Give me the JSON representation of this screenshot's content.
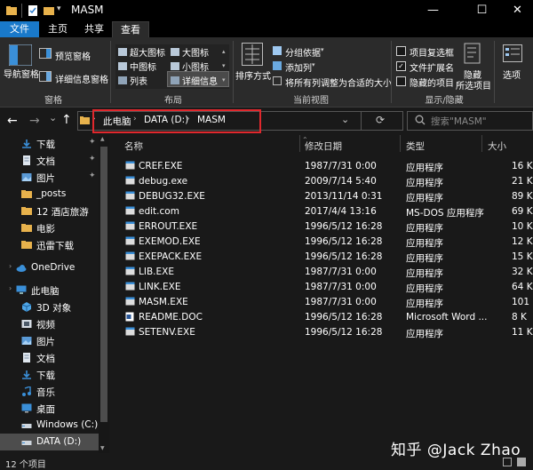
{
  "window": {
    "title": "MASM",
    "minimize": "—",
    "maximize": "☐",
    "close": "✕"
  },
  "tabs": [
    "文件",
    "主页",
    "共享",
    "查看"
  ],
  "ribbon": {
    "pane": {
      "nav_pane": "导航窗格",
      "preview_pane": "预览窗格",
      "details_pane": "详细信息窗格",
      "group_label": "窗格"
    },
    "layout": {
      "xl_icons": "超大图标",
      "large_icons": "大图标",
      "medium_icons": "中图标",
      "small_icons": "小图标",
      "list": "列表",
      "details": "详细信息",
      "group_label": "布局"
    },
    "current_view": {
      "sort_by": "排序方式",
      "group_by": "分组依据",
      "add_columns": "添加列",
      "size_all_columns": "将所有列调整为合适的大小",
      "group_label": "当前视图"
    },
    "show_hide": {
      "item_checkboxes": "项目复选框",
      "file_extensions": "文件扩展名",
      "hidden_items": "隐藏的项目",
      "hide_selected_1": "隐藏",
      "hide_selected_2": "所选项目",
      "group_label": "显示/隐藏",
      "options": "选项"
    }
  },
  "nav": {
    "back": "←",
    "forward": "→",
    "recent": "⌄",
    "up": "↑",
    "breadcrumb": [
      "此电脑",
      "DATA (D:)",
      "MASM"
    ],
    "sep": "›",
    "dropdown": "⌄",
    "refresh": "⟳",
    "search_placeholder": "搜索\"MASM\""
  },
  "sidebar": {
    "items": [
      {
        "label": "下载",
        "icon": "download-icon",
        "pinned": true
      },
      {
        "label": "文档",
        "icon": "document-icon",
        "pinned": true
      },
      {
        "label": "图片",
        "icon": "picture-icon",
        "pinned": true
      },
      {
        "label": "_posts",
        "icon": "folder-icon",
        "pinned": false
      },
      {
        "label": "12 酒店旅游",
        "icon": "folder-icon",
        "pinned": false
      },
      {
        "label": "电影",
        "icon": "folder-icon",
        "pinned": false
      },
      {
        "label": "迅雷下载",
        "icon": "folder-icon",
        "pinned": false
      },
      {
        "label": "OneDrive",
        "icon": "cloud-icon",
        "pinned": false
      },
      {
        "label": "此电脑",
        "icon": "computer-icon",
        "pinned": false
      },
      {
        "label": "3D 对象",
        "icon": "cube-icon",
        "pinned": false
      },
      {
        "label": "视频",
        "icon": "video-icon",
        "pinned": false
      },
      {
        "label": "图片",
        "icon": "picture-icon",
        "pinned": false
      },
      {
        "label": "文档",
        "icon": "document-icon",
        "pinned": false
      },
      {
        "label": "下载",
        "icon": "download-icon",
        "pinned": false
      },
      {
        "label": "音乐",
        "icon": "music-icon",
        "pinned": false
      },
      {
        "label": "桌面",
        "icon": "desktop-icon",
        "pinned": false
      },
      {
        "label": "Windows (C:)",
        "icon": "drive-icon",
        "pinned": false
      },
      {
        "label": "DATA (D:)",
        "icon": "drive-icon",
        "pinned": false
      }
    ],
    "pin_glyph": "✦"
  },
  "columns": {
    "name": "名称",
    "date": "修改日期",
    "type": "类型",
    "size": "大小"
  },
  "files": [
    {
      "name": "CREF.EXE",
      "date": "1987/7/31 0:00",
      "type": "应用程序",
      "size": "16 K"
    },
    {
      "name": "debug.exe",
      "date": "2009/7/14 5:40",
      "type": "应用程序",
      "size": "21 K"
    },
    {
      "name": "DEBUG32.EXE",
      "date": "2013/11/14 0:31",
      "type": "应用程序",
      "size": "89 K"
    },
    {
      "name": "edit.com",
      "date": "2017/4/4 13:16",
      "type": "MS-DOS 应用程序",
      "size": "69 K"
    },
    {
      "name": "ERROUT.EXE",
      "date": "1996/5/12 16:28",
      "type": "应用程序",
      "size": "10 K"
    },
    {
      "name": "EXEMOD.EXE",
      "date": "1996/5/12 16:28",
      "type": "应用程序",
      "size": "12 K"
    },
    {
      "name": "EXEPACK.EXE",
      "date": "1996/5/12 16:28",
      "type": "应用程序",
      "size": "15 K"
    },
    {
      "name": "LIB.EXE",
      "date": "1987/7/31 0:00",
      "type": "应用程序",
      "size": "32 K"
    },
    {
      "name": "LINK.EXE",
      "date": "1987/7/31 0:00",
      "type": "应用程序",
      "size": "64 K"
    },
    {
      "name": "MASM.EXE",
      "date": "1987/7/31 0:00",
      "type": "应用程序",
      "size": "101 K"
    },
    {
      "name": "README.DOC",
      "date": "1996/5/12 16:28",
      "type": "Microsoft Word ...",
      "size": "8 K"
    },
    {
      "name": "SETENV.EXE",
      "date": "1996/5/12 16:28",
      "type": "应用程序",
      "size": "11 K"
    }
  ],
  "status": {
    "count": "12 个项目"
  },
  "watermark": "知乎 @Jack Zhao",
  "colors": {
    "accent": "#1979ca",
    "highlight_box": "#e0282d",
    "folder": "#e8b24c",
    "background": "#191919"
  }
}
